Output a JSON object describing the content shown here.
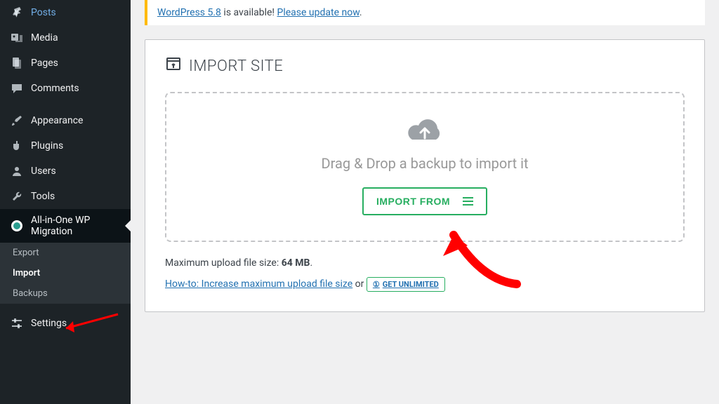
{
  "sidebar": {
    "items": [
      {
        "label": "Posts",
        "icon": "pin"
      },
      {
        "label": "Media",
        "icon": "media"
      },
      {
        "label": "Pages",
        "icon": "pages"
      },
      {
        "label": "Comments",
        "icon": "comment"
      },
      {
        "label": "Appearance",
        "icon": "brush"
      },
      {
        "label": "Plugins",
        "icon": "plug"
      },
      {
        "label": "Users",
        "icon": "user"
      },
      {
        "label": "Tools",
        "icon": "wrench"
      },
      {
        "label": "All-in-One WP Migration",
        "icon": "migrate"
      },
      {
        "label": "Settings",
        "icon": "sliders"
      }
    ],
    "submenu": [
      {
        "label": "Export"
      },
      {
        "label": "Import"
      },
      {
        "label": "Backups"
      }
    ]
  },
  "notice": {
    "prefix_link": "WordPress 5.8",
    "middle": " is available! ",
    "action_link": "Please update now",
    "suffix": "."
  },
  "panel": {
    "title": "IMPORT SITE",
    "drop_text": "Drag & Drop a backup to import it",
    "import_button": "IMPORT FROM"
  },
  "info": {
    "max_upload_label": "Maximum upload file size: ",
    "max_upload_value": "64 MB",
    "max_upload_suffix": ".",
    "howto_link": "How-to: Increase maximum upload file size",
    "or": " or ",
    "unlimited": "GET UNLIMITED"
  }
}
